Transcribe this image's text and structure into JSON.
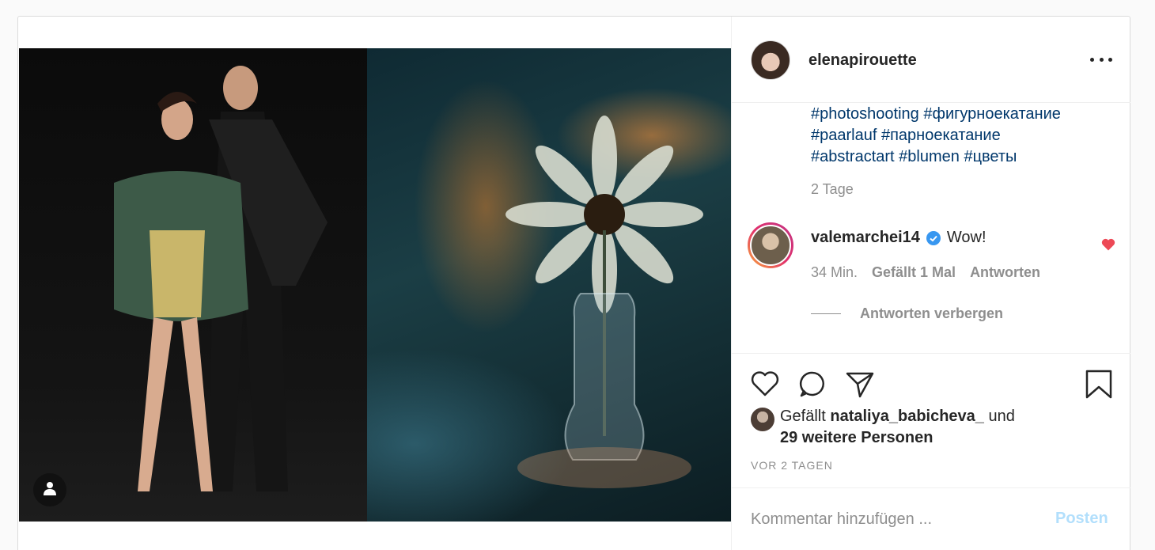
{
  "post": {
    "owner": {
      "username": "elenapirouette"
    },
    "caption_hashtags": [
      "#photoshooting",
      "#фигурноекатание",
      "#paarlauf",
      "#парноекатание",
      "#abstractart",
      "#blumen",
      "#цветы"
    ],
    "caption_time": "2 Tage",
    "comment": {
      "username": "valemarchei14",
      "text": "Wow!",
      "time": "34 Min.",
      "likes": "Gefällt 1 Mal",
      "reply": "Antworten",
      "hide_replies": "Antworten verbergen"
    },
    "likes": {
      "prefix": "Gefällt",
      "liked_by": "nataliya_babicheva_",
      "and": "und",
      "others": "29 weitere Personen"
    },
    "date": "VOR 2 TAGEN",
    "comment_input": {
      "placeholder": "Kommentar hinzufügen ..."
    },
    "post_button": "Posten"
  },
  "colors": {
    "hashtag": "#00376b",
    "muted": "#8e8e8e",
    "heart": "#ed4956",
    "verified": "#3897f0",
    "post_button": "#b2dffc"
  },
  "icons": [
    "user-tag-icon",
    "more-options-icon",
    "verified-icon",
    "heart-icon",
    "like-icon",
    "comment-icon",
    "share-icon",
    "save-icon"
  ]
}
